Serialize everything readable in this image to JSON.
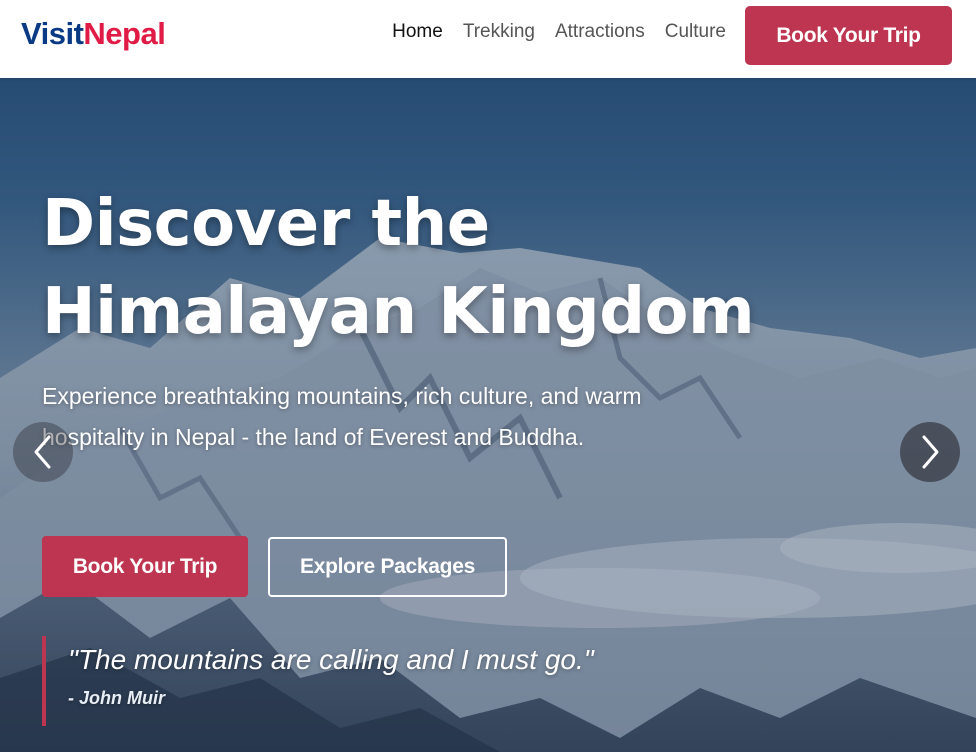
{
  "brand": {
    "part1": "Visit",
    "part2": "Nepal",
    "color1": "#0b3a84",
    "color2": "#e01b46"
  },
  "nav": {
    "links": [
      {
        "label": "Home",
        "active": true
      },
      {
        "label": "Trekking",
        "active": false
      },
      {
        "label": "Attractions",
        "active": false
      },
      {
        "label": "Culture",
        "active": false
      }
    ],
    "cta_label": "Book Your Trip"
  },
  "hero": {
    "headline_line1": "Discover the",
    "headline_line2": "Himalayan Kingdom",
    "subtext": "Experience breathtaking mountains, rich culture, and warm hospitality in Nepal - the land of Everest and Buddha.",
    "primary_button": "Book Your Trip",
    "secondary_button": "Explore Packages",
    "quote": "\"The mountains are calling and I must go.\"",
    "quote_author": "- John Muir",
    "prev_icon": "chevron-left-icon",
    "next_icon": "chevron-right-icon"
  },
  "colors": {
    "accent": "#bd3550",
    "brand_blue": "#0b3a84",
    "brand_red": "#e01b46"
  }
}
